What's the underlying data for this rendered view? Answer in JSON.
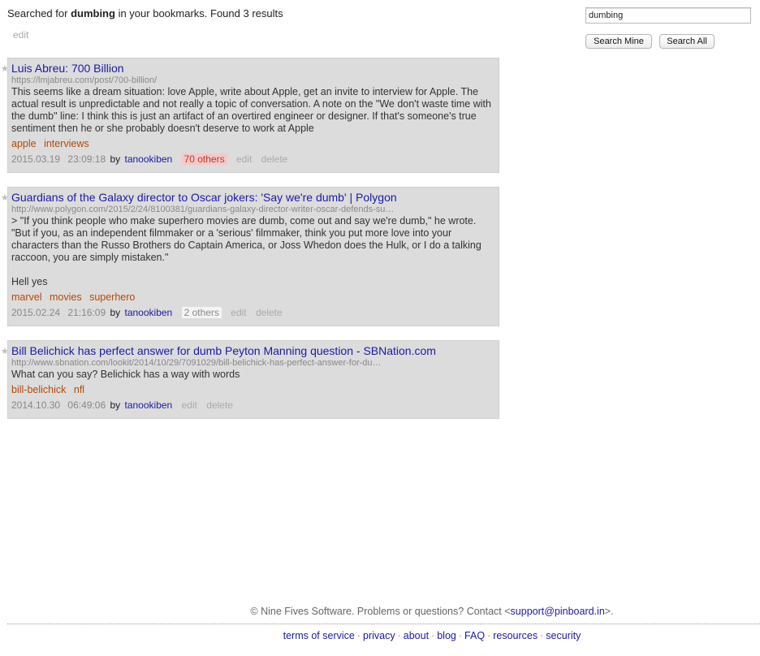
{
  "search": {
    "summary_prefix": "Searched for",
    "query": "dumbing",
    "summary_suffix": "in your bookmarks. Found 3 results",
    "edit_label": "edit",
    "input_value": "dumbing",
    "search_mine_label": "Search Mine",
    "search_all_label": "Search All"
  },
  "bookmarks": [
    {
      "title": "Luis Abreu: 700 Billion",
      "url": "https://lmjabreu.com/post/700-billion/",
      "description": "This seems like a dream situation: love Apple, write about Apple, get an invite to interview for Apple. The actual result is unpredictable and not really a topic of conversation. A note on the \"We don't waste time with the dumb\" line: I think this is just an artifact of an overtired engineer or designer. If that's someone's true sentiment then he or she probably doesn't deserve to work at Apple",
      "tags": [
        "apple",
        "interviews"
      ],
      "date": "2015.03.19",
      "time": "23:09:18",
      "by": "by",
      "user": "tanookiben",
      "others": "70 others",
      "edit": "edit",
      "delete": "delete"
    },
    {
      "title": "Guardians of the Galaxy director to Oscar jokers: 'Say we're dumb' | Polygon",
      "url": "http://www.polygon.com/2015/2/24/8100381/guardians-galaxy-director-writer-oscar-defends-su…",
      "description": "> \"If you think people who make superhero movies are dumb, come out and say we're dumb,\" he wrote. \"But if you, as an independent filmmaker or a 'serious' filmmaker, think you put more love into your characters than the Russo Brothers do Captain America, or Joss Whedon does the Hulk, or I do a talking raccoon, you are simply mistaken.\"\n\nHell yes",
      "tags": [
        "marvel",
        "movies",
        "superhero"
      ],
      "date": "2015.02.24",
      "time": "21:16:09",
      "by": "by",
      "user": "tanookiben",
      "others": "2 others",
      "edit": "edit",
      "delete": "delete"
    },
    {
      "title": "Bill Belichick has perfect answer for dumb Peyton Manning question - SBNation.com",
      "url": "http://www.sbnation.com/lookit/2014/10/29/7091029/bill-belichick-has-perfect-answer-for-du…",
      "description": "What can you say? Belichick has a way with words",
      "tags": [
        "bill-belichick",
        "nfl"
      ],
      "date": "2014.10.30",
      "time": "06:49:06",
      "by": "by",
      "user": "tanookiben",
      "edit": "edit",
      "delete": "delete"
    }
  ],
  "footer": {
    "note_prefix": "© Nine Fives Software. Problems or questions? Contact <",
    "email": "support@pinboard.in",
    "note_suffix": ">.",
    "links": [
      "terms of service",
      "privacy",
      "about",
      "blog",
      "FAQ",
      "resources",
      "security"
    ],
    "separator": "·"
  },
  "colors": {
    "link": "#1a1aa6",
    "tag": "#b14a0a",
    "bookmark_bg": "#dcdcdc",
    "others_hot_bg": "#f3c9c9"
  }
}
